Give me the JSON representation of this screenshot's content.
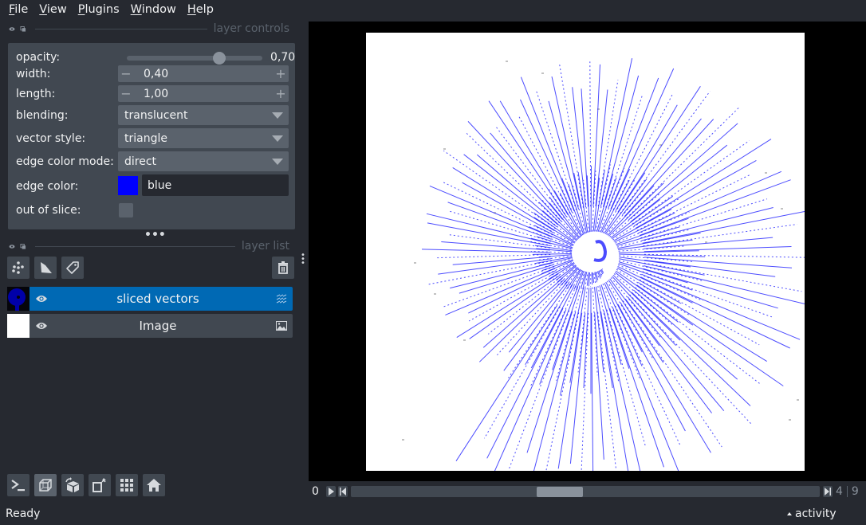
{
  "menu": [
    {
      "label": "File",
      "mnemonic": "F",
      "rest": "ile"
    },
    {
      "label": "View",
      "mnemonic": "V",
      "rest": "iew"
    },
    {
      "label": "Plugins",
      "mnemonic": "P",
      "rest": "lugins"
    },
    {
      "label": "Window",
      "mnemonic": "W",
      "rest": "indow"
    },
    {
      "label": "Help",
      "mnemonic": "H",
      "rest": "elp"
    }
  ],
  "layer_controls": {
    "title": "layer controls",
    "opacity": {
      "label": "opacity:",
      "value": 0.7,
      "display": "0,70"
    },
    "width": {
      "label": "width:",
      "value": "0,40",
      "minus": "−",
      "plus": "+"
    },
    "length": {
      "label": "length:",
      "value": "1,00",
      "minus": "−",
      "plus": "+"
    },
    "blending": {
      "label": "blending:",
      "value": "translucent"
    },
    "vector_style": {
      "label": "vector style:",
      "value": "triangle"
    },
    "edge_color_mode": {
      "label": "edge color mode:",
      "value": "direct"
    },
    "edge_color": {
      "label": "edge color:",
      "value": "blue",
      "swatch": "#0000ff"
    },
    "out_of_slice": {
      "label": "out of slice:",
      "checked": false
    }
  },
  "splitter_handle": "•••",
  "layer_list": {
    "title": "layer list",
    "buttons": [
      "new-points-layer",
      "new-shapes-layer",
      "new-labels-layer"
    ],
    "delete_button": "delete-layer",
    "layers": [
      {
        "name": "sliced vectors",
        "visible": true,
        "selected": true,
        "type": "vectors"
      },
      {
        "name": "Image",
        "visible": true,
        "selected": false,
        "type": "image"
      }
    ]
  },
  "bottom_buttons": [
    "console",
    "toggle-ndisplay",
    "roll-dimensions",
    "transpose-dimensions",
    "grid-view",
    "reset-view"
  ],
  "status": "Ready",
  "activity": "activity",
  "dims": {
    "index_label": "0",
    "current": "4",
    "max": "9",
    "position_fraction": 0.44
  },
  "colors": {
    "accent": "#0069b4",
    "vector_color": "#0000ff",
    "background": "#262930",
    "panel": "#414851"
  }
}
